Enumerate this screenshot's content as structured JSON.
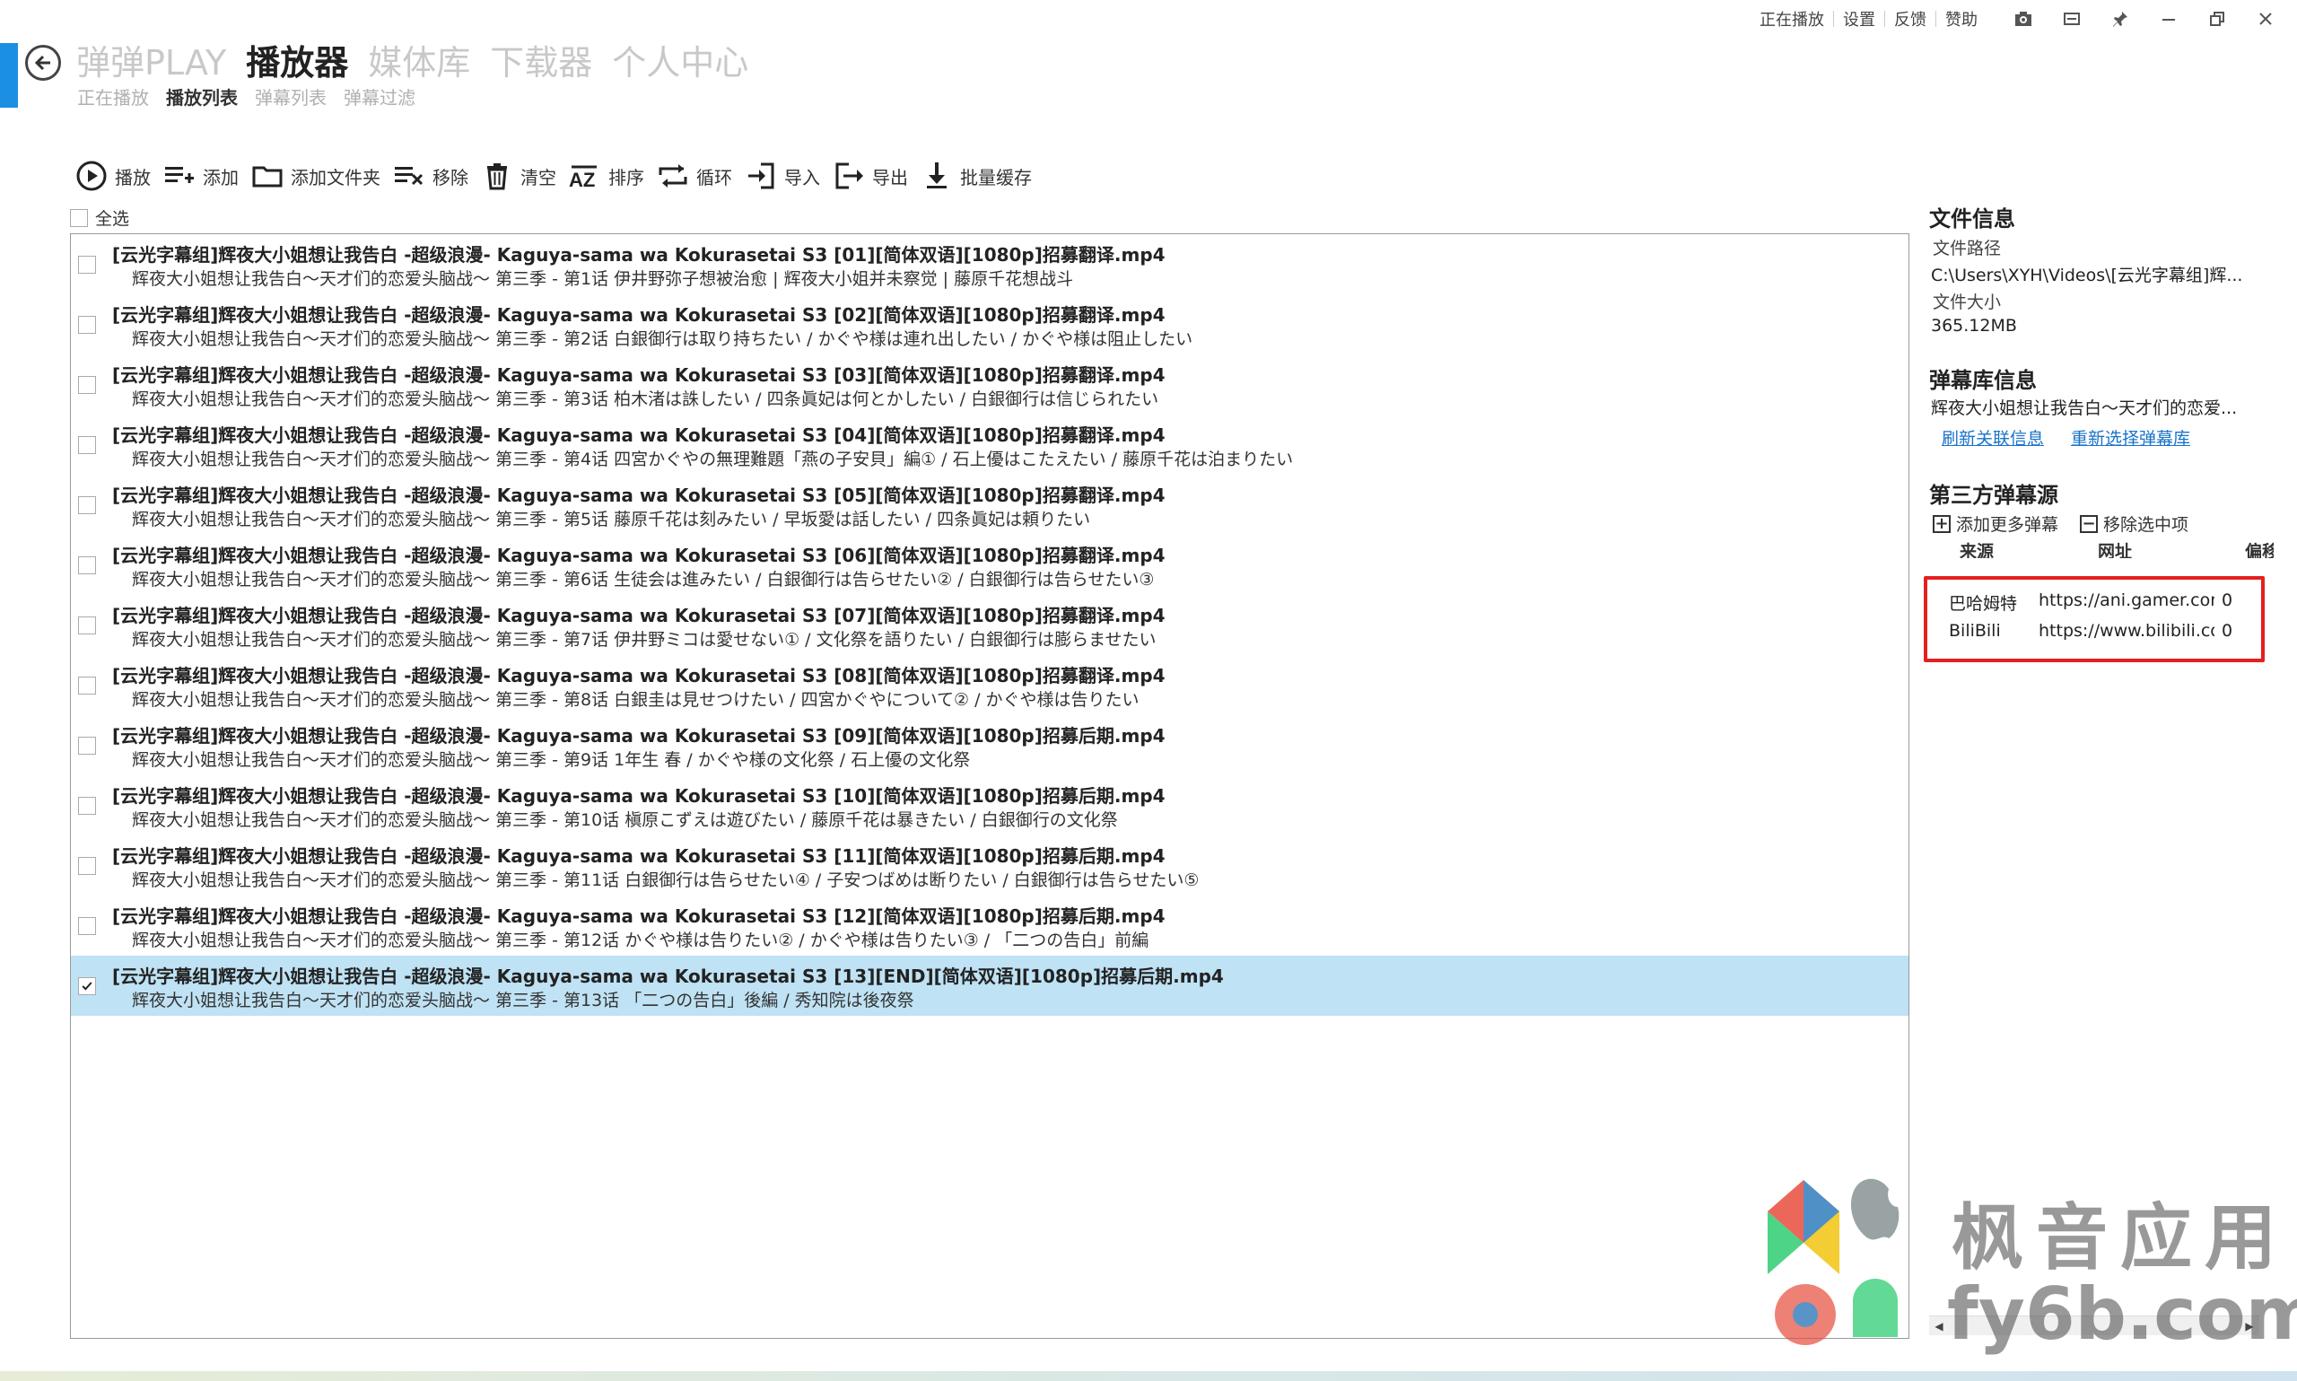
{
  "nav": {
    "main": [
      "弹弹PLAY",
      "播放器",
      "媒体库",
      "下载器",
      "个人中心"
    ],
    "sub": [
      "正在播放",
      "播放列表",
      "弹幕列表",
      "弹幕过滤"
    ]
  },
  "top_links": [
    "正在播放",
    "设置",
    "反馈",
    "赞助"
  ],
  "toolbar": {
    "play": "播放",
    "add": "添加",
    "add_folder": "添加文件夹",
    "remove": "移除",
    "clear": "清空",
    "sort": "排序",
    "loop": "循环",
    "import": "导入",
    "export": "导出",
    "batch_cache": "批量缓存"
  },
  "select_all": "全选",
  "playlist": [
    {
      "title": "[云光字幕组]辉夜大小姐想让我告白 -超级浪漫- Kaguya-sama wa Kokurasetai S3 [01][简体双语][1080p]招募翻译.mp4",
      "subtitle": "辉夜大小姐想让我告白～天才们的恋爱头脑战～ 第三季 - 第1话 伊井野弥子想被治愈 | 辉夜大小姐并未察觉 | 藤原千花想战斗",
      "checked": false
    },
    {
      "title": "[云光字幕组]辉夜大小姐想让我告白 -超级浪漫- Kaguya-sama wa Kokurasetai S3 [02][简体双语][1080p]招募翻译.mp4",
      "subtitle": "辉夜大小姐想让我告白～天才们的恋爱头脑战～ 第三季 - 第2话 白銀御行は取り持ちたい / かぐや様は連れ出したい / かぐや様は阻止したい",
      "checked": false
    },
    {
      "title": "[云光字幕组]辉夜大小姐想让我告白 -超级浪漫- Kaguya-sama wa Kokurasetai S3 [03][简体双语][1080p]招募翻译.mp4",
      "subtitle": "辉夜大小姐想让我告白～天才们的恋爱头脑战～ 第三季 - 第3话 柏木渚は誅したい / 四条眞妃は何とかしたい / 白銀御行は信じられたい",
      "checked": false
    },
    {
      "title": "[云光字幕组]辉夜大小姐想让我告白 -超级浪漫- Kaguya-sama wa Kokurasetai S3 [04][简体双语][1080p]招募翻译.mp4",
      "subtitle": "辉夜大小姐想让我告白～天才们的恋爱头脑战～ 第三季 - 第4话 四宮かぐやの無理難題「燕の子安貝」編① / 石上優はこたえたい / 藤原千花は泊まりたい",
      "checked": false
    },
    {
      "title": "[云光字幕组]辉夜大小姐想让我告白 -超级浪漫- Kaguya-sama wa Kokurasetai S3 [05][简体双语][1080p]招募翻译.mp4",
      "subtitle": "辉夜大小姐想让我告白～天才们的恋爱头脑战～ 第三季 - 第5话 藤原千花は刻みたい / 早坂愛は話したい / 四条眞妃は頼りたい",
      "checked": false
    },
    {
      "title": "[云光字幕组]辉夜大小姐想让我告白 -超级浪漫- Kaguya-sama wa Kokurasetai S3 [06][简体双语][1080p]招募翻译.mp4",
      "subtitle": "辉夜大小姐想让我告白～天才们的恋爱头脑战～ 第三季 - 第6话 生徒会は進みたい / 白銀御行は告らせたい② / 白銀御行は告らせたい③",
      "checked": false
    },
    {
      "title": "[云光字幕组]辉夜大小姐想让我告白 -超级浪漫- Kaguya-sama wa Kokurasetai S3 [07][简体双语][1080p]招募翻译.mp4",
      "subtitle": "辉夜大小姐想让我告白～天才们的恋爱头脑战～ 第三季 - 第7话 伊井野ミコは愛せない① / 文化祭を語りたい / 白銀御行は膨らませたい",
      "checked": false
    },
    {
      "title": "[云光字幕组]辉夜大小姐想让我告白 -超级浪漫- Kaguya-sama wa Kokurasetai S3 [08][简体双语][1080p]招募翻译.mp4",
      "subtitle": "辉夜大小姐想让我告白～天才们的恋爱头脑战～ 第三季 - 第8话 白銀圭は見せつけたい / 四宮かぐやについて② / かぐや様は告りたい",
      "checked": false
    },
    {
      "title": "[云光字幕组]辉夜大小姐想让我告白 -超级浪漫- Kaguya-sama wa Kokurasetai S3 [09][简体双语][1080p]招募后期.mp4",
      "subtitle": "辉夜大小姐想让我告白～天才们的恋爱头脑战～ 第三季 - 第9话 1年生 春 / かぐや様の文化祭 / 石上優の文化祭",
      "checked": false
    },
    {
      "title": "[云光字幕组]辉夜大小姐想让我告白 -超级浪漫- Kaguya-sama wa Kokurasetai S3 [10][简体双语][1080p]招募后期.mp4",
      "subtitle": "辉夜大小姐想让我告白～天才们的恋爱头脑战～ 第三季 - 第10话 槇原こずえは遊びたい / 藤原千花は暴きたい / 白銀御行の文化祭",
      "checked": false
    },
    {
      "title": "[云光字幕组]辉夜大小姐想让我告白 -超级浪漫- Kaguya-sama wa Kokurasetai S3 [11][简体双语][1080p]招募后期.mp4",
      "subtitle": "辉夜大小姐想让我告白～天才们的恋爱头脑战～ 第三季 - 第11话 白銀御行は告らせたい④ / 子安つばめは断りたい / 白銀御行は告らせたい⑤",
      "checked": false
    },
    {
      "title": "[云光字幕组]辉夜大小姐想让我告白 -超级浪漫- Kaguya-sama wa Kokurasetai S3 [12][简体双语][1080p]招募后期.mp4",
      "subtitle": "辉夜大小姐想让我告白～天才们的恋爱头脑战～ 第三季 - 第12话 かぐや様は告りたい② / かぐや様は告りたい③ / 「二つの告白」前編",
      "checked": false
    },
    {
      "title": "[云光字幕组]辉夜大小姐想让我告白 -超级浪漫- Kaguya-sama wa Kokurasetai S3 [13][END][简体双语][1080p]招募后期.mp4",
      "subtitle": "辉夜大小姐想让我告白～天才们的恋爱头脑战～ 第三季 - 第13话 「二つの告白」後編 / 秀知院は後夜祭",
      "checked": true
    }
  ],
  "file_info": {
    "heading": "文件信息",
    "path_label": "文件路径",
    "path_value": "C:\\Users\\XYH\\Videos\\[云光字幕组]辉...",
    "size_label": "文件大小",
    "size_value": "365.12MB"
  },
  "danmaku_lib": {
    "heading": "弹幕库信息",
    "value": "辉夜大小姐想让我告白～天才们的恋爱...",
    "refresh_link": "刷新关联信息",
    "reselect_link": "重新选择弹幕库"
  },
  "third_party": {
    "heading": "第三方弹幕源",
    "add_more": "添加更多弹幕",
    "remove_selected": "移除选中项",
    "columns": [
      "来源",
      "网址",
      "偏移"
    ],
    "rows": [
      {
        "source": "巴哈姆特",
        "url": "https://ani.gamer.com",
        "offset": "0"
      },
      {
        "source": "BiliBili",
        "url": "https://www.bilibili.com",
        "offset": "0"
      }
    ]
  },
  "watermark": {
    "line1": "枫音应用",
    "line2": "fy6b.com"
  },
  "colors": {
    "accent": "#1a8fe3",
    "selected_row": "#bfe2f4",
    "link": "#1a73c9",
    "highlight": "#e42020"
  }
}
